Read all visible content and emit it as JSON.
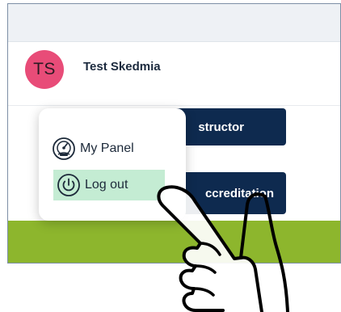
{
  "user": {
    "initials": "TS",
    "name": "Test Skedmia"
  },
  "buttons": {
    "instructor_label": "structor",
    "accreditation_label": "ccreditation"
  },
  "menu": {
    "items": [
      {
        "label": "My Panel",
        "icon": "dashboard-icon"
      },
      {
        "label": "Log out",
        "icon": "power-icon"
      }
    ]
  },
  "colors": {
    "avatar": "#e84c78",
    "button_dark": "#0e2a4f",
    "band_green": "#8db62d",
    "hover_highlight": "#c4ecd3"
  },
  "overlay": {
    "icon": "pointing-hand-icon"
  }
}
